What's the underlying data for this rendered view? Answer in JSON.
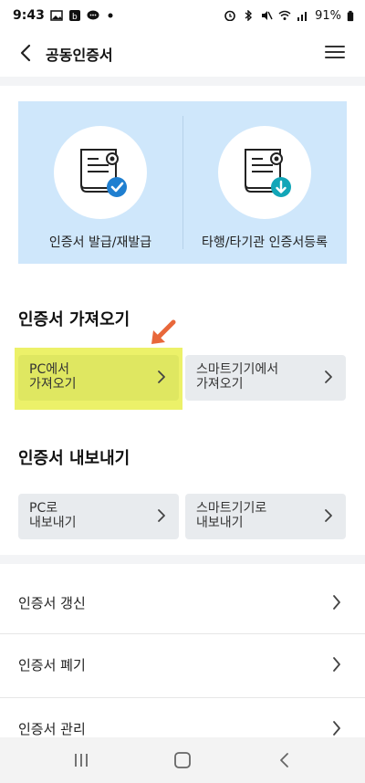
{
  "status_bar": {
    "time": "9:43",
    "battery": "91%"
  },
  "header": {
    "title": "공동인증서"
  },
  "top_panel": {
    "left_label": "인증서 발급/재발급",
    "right_label": "타행/타기관 인증서등록"
  },
  "import_section": {
    "title": "인증서 가져오기",
    "pc_line1": "PC에서",
    "pc_line2": "가져오기",
    "phone_line1": "스마트기기에서",
    "phone_line2": "가져오기"
  },
  "export_section": {
    "title": "인증서 내보내기",
    "pc_line1": "PC로",
    "pc_line2": "내보내기",
    "phone_line1": "스마트기기로",
    "phone_line2": "내보내기"
  },
  "list": {
    "renew": "인증서 갱신",
    "revoke": "인증서 폐기",
    "manage": "인증서 관리"
  },
  "colors": {
    "panel_bg": "#cfe7fb",
    "highlight": "#ecf169",
    "arrow": "#e8673a",
    "badge_blue": "#1f7fd0",
    "badge_teal": "#12a6b8"
  }
}
